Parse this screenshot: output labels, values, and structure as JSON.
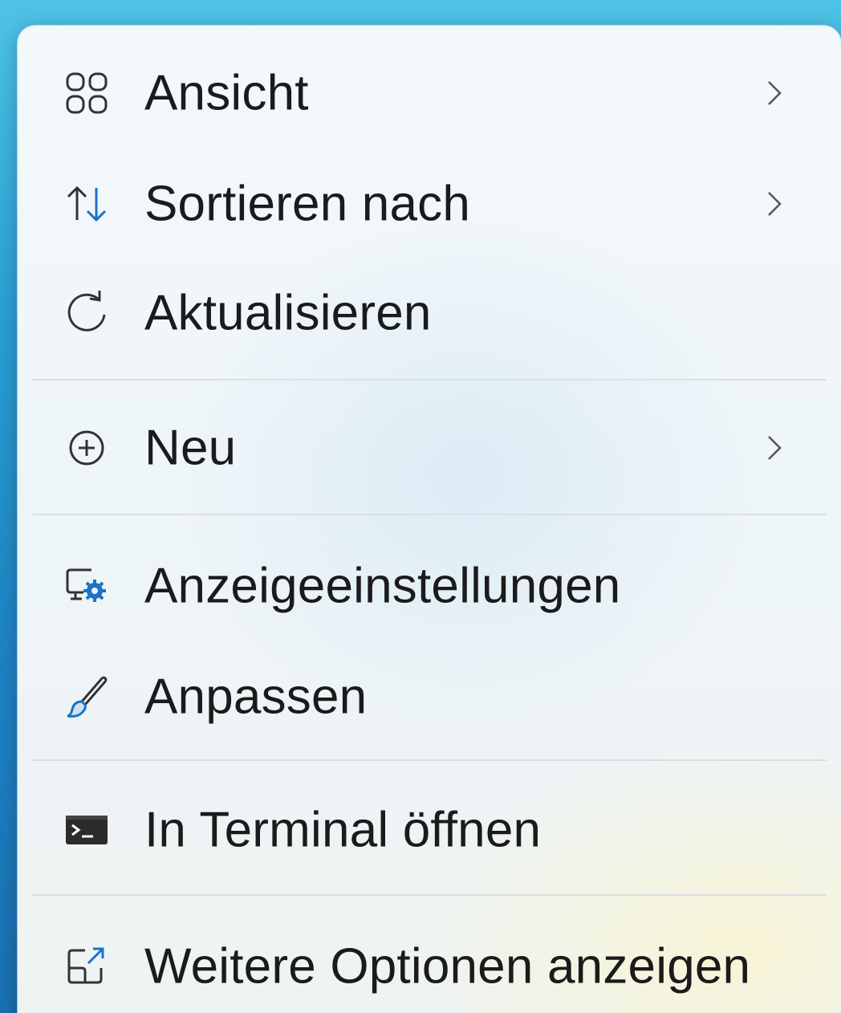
{
  "menu": {
    "items": [
      {
        "label": "Ansicht",
        "icon": "grid-view-icon",
        "submenu": true
      },
      {
        "label": "Sortieren nach",
        "icon": "sort-arrows-icon",
        "submenu": true
      },
      {
        "label": "Aktualisieren",
        "icon": "refresh-icon",
        "submenu": false
      },
      {
        "label": "Neu",
        "icon": "add-circle-icon",
        "submenu": true
      },
      {
        "label": "Anzeigeeinstellungen",
        "icon": "display-settings-icon",
        "submenu": false
      },
      {
        "label": "Anpassen",
        "icon": "paintbrush-icon",
        "submenu": false
      },
      {
        "label": "In Terminal öffnen",
        "icon": "terminal-icon",
        "submenu": false
      },
      {
        "label": "Weitere Optionen anzeigen",
        "icon": "more-options-icon",
        "submenu": false
      }
    ]
  },
  "colors": {
    "accent": "#1a73c9",
    "text": "#1b1b1b",
    "separator": "#dcdfe2"
  }
}
